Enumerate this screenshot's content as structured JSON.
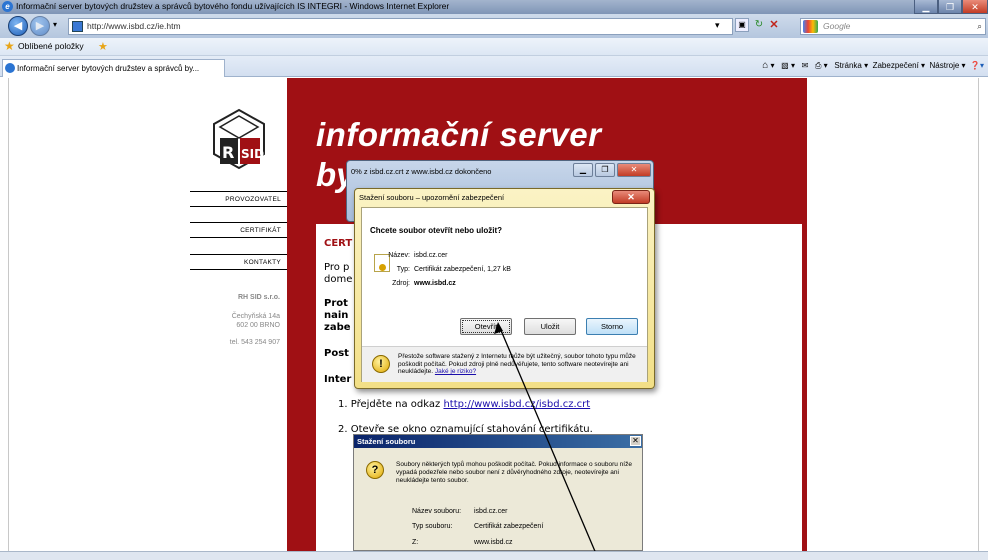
{
  "window": {
    "title": "Informační server bytových družstev a správců bytového fondu užívajících IS INTEGRI - Windows Internet Explorer",
    "url": "http://www.isbd.cz/ie.htm",
    "url_domain": "isbd.cz",
    "search_placeholder": "Google"
  },
  "favorites": {
    "label": "Oblíbené položky"
  },
  "tab": {
    "label": "Informační server bytových družstev a správců by..."
  },
  "commandbar": {
    "page": "Stránka ▾",
    "security": "Zabezpečení ▾",
    "tools": "Nástroje ▾"
  },
  "site": {
    "title_line1": "informační server",
    "title_line2": "by",
    "menu": [
      "PROVOZOVATEL",
      "CERTIFIKÁT",
      "KONTAKTY"
    ],
    "company": "RH SID s.r.o.",
    "street": "Čechyňská 14a",
    "city": "602 00 BRNO",
    "phone": "tel. 543 254 907"
  },
  "article": {
    "heading": "CERT",
    "p1a": "Pro p",
    "p1b": "dome",
    "p2a": "Prot",
    "p2b": "nain",
    "p2c": "zabe",
    "p3": "Post",
    "p4": "Inter",
    "step1": "1. Přejděte na odkaz",
    "step1_link": "http://www.isbd.cz/isbd.cz.crt",
    "step2": "2. Otevře se okno oznamující stahování certifikátu."
  },
  "progress_dialog": {
    "title": "0% z isbd.cz.crt z www.isbd.cz dokončeno"
  },
  "download_dialog": {
    "title": "Stažení souboru – upozornění zabezpečení",
    "question": "Chcete soubor otevřít nebo uložit?",
    "name_label": "Název:",
    "name_value": "isbd.cz.cer",
    "type_label": "Typ:",
    "type_value": "Certifikát zabezpečení, 1,27 kB",
    "source_label": "Zdroj:",
    "source_value": "www.isbd.cz",
    "open_button": "Otevřít",
    "save_button": "Uložit",
    "cancel_button": "Storno",
    "warning": "Přestože software stažený z Internetu může být užitečný, soubor tohoto typu může poškodit počítač. Pokud zdroji plně nedůvěřujete, tento software neotevírejte ani neukládejte.",
    "risk_link": "Jaké je riziko?"
  },
  "screenshot_dialog": {
    "title": "Stažení souboru",
    "text": "Soubory některých typů mohou poškodit počítač. Pokud informace o souboru níže vypadá podezřele nebo soubor není z důvěryhodného zdroje, neotevírejte ani neukládejte tento soubor.",
    "name_label": "Název souboru:",
    "name_value": "isbd.cz.cer",
    "type_label": "Typ souboru:",
    "type_value": "Certifikát zabezpečení",
    "from_label": "Z:",
    "from_value": "www.isbd.cz"
  }
}
